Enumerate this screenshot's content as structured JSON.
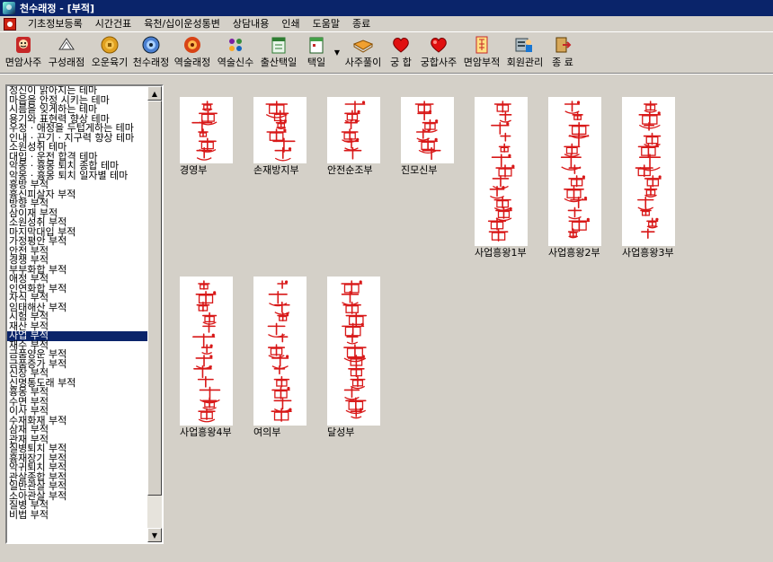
{
  "window": {
    "title": "천수래정 - [부적]"
  },
  "menu": [
    "기초정보등록",
    "시간건표",
    "육천/십이운성통변",
    "상담내용",
    "인쇄",
    "도움말",
    "종료"
  ],
  "toolbar": [
    {
      "label": "면암사주",
      "icon": "face-icon"
    },
    {
      "label": "구성래점",
      "icon": "scroll-icon"
    },
    {
      "label": "오운육기",
      "icon": "coin-icon"
    },
    {
      "label": "천수래정",
      "icon": "globe-icon"
    },
    {
      "label": "역술래정",
      "icon": "flower-icon"
    },
    {
      "label": "역술신수",
      "icon": "beads-icon"
    },
    {
      "label": "출산택일",
      "icon": "calendar-icon"
    },
    {
      "label": "택일",
      "icon": "calendar2-icon"
    },
    {
      "label": "사주풀이",
      "icon": "book-icon"
    },
    {
      "label": "궁 합",
      "icon": "heart-icon"
    },
    {
      "label": "궁합사주",
      "icon": "heart2-icon"
    },
    {
      "label": "면암부적",
      "icon": "talisman-icon"
    },
    {
      "label": "회원관리",
      "icon": "members-icon"
    },
    {
      "label": "종 료",
      "icon": "exit-icon"
    }
  ],
  "categories": [
    "정신이 맑아지는 테마",
    "마음을 안정 시키는 테마",
    "시름을 잊게하는 테마",
    "용기와 표현력 향상 테마",
    "우정 · 애정을 두텁게하는 테마",
    "인내 · 끈기 · 지구력 향상 테마",
    "소원성취 테마",
    "대입 · 운전 합격 테마",
    "악몽 · 흉몽 퇴치 종합 테마",
    "악몽 · 흉몽 퇴치 일자별 테마",
    "흉방 부적",
    "흉신피살자 부적",
    "방향 부적",
    "삼이재 부적",
    "소원성취 부적",
    "마지막대입 부적",
    "가정평안 부적",
    "안전 부적",
    "경쟁 부적",
    "부부화합 부적",
    "애정 부적",
    "인연화합 부적",
    "자식 부적",
    "임태해산 부적",
    "시험 부적",
    "재산 부적",
    "사업 부적",
    "재수 부적",
    "금품양운 부적",
    "금품증가 부적",
    "신장 부적",
    "신명통도래 부적",
    "흉몽 부적",
    "수면 부적",
    "이사 부적",
    "수재화재 부적",
    "삼재 부적",
    "관재 부적",
    "질병퇴치 부적",
    "흉재장기 부적",
    "악귀퇴치 부적",
    "관살종합 부적",
    "일반관살 부적",
    "소아관살 부적",
    "질병 부적",
    "비법 부적"
  ],
  "selected_category": "사업 부적",
  "talismans": [
    {
      "name": "경영부"
    },
    {
      "name": "손재방지부"
    },
    {
      "name": "안전순조부"
    },
    {
      "name": "진모신부"
    },
    {
      "name": "사업흥왕1부"
    },
    {
      "name": "사업흥왕2부"
    },
    {
      "name": "사업흥왕3부"
    },
    {
      "name": "사업흥왕4부"
    },
    {
      "name": "여의부"
    },
    {
      "name": "달성부"
    }
  ],
  "colors": {
    "titlebar": "#0a246a",
    "ink": "#d81818",
    "selection": "#0a246a",
    "background": "#d4d0c8"
  }
}
